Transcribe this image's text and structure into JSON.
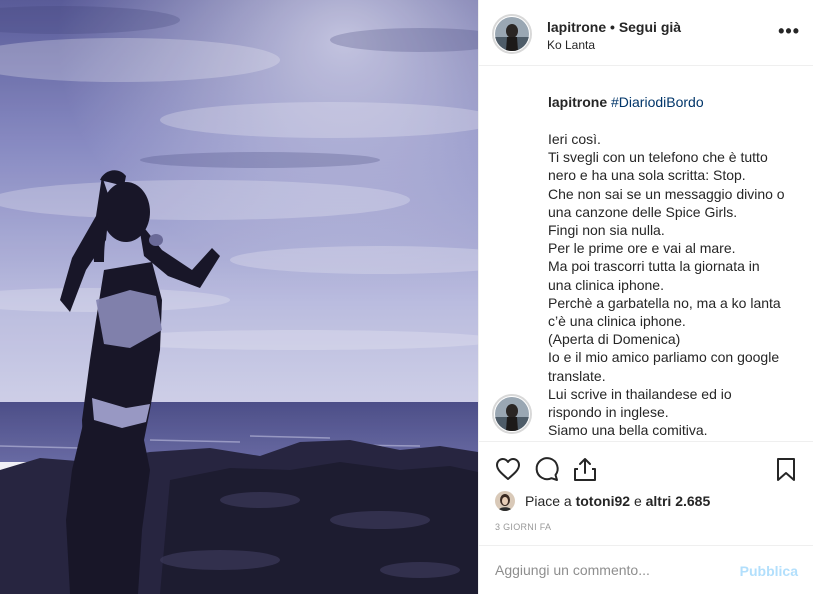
{
  "header": {
    "username": "lapitrone",
    "separator": "•",
    "follow_label": "Segui già",
    "location": "Ko Lanta",
    "more_icon": "more-options-icon",
    "more_glyph": "•••"
  },
  "caption": {
    "username": "lapitrone",
    "hashtag": "#DiariodiBordo",
    "lines": [
      "Ieri così.",
      "Ti svegli con un telefono che è tutto",
      "nero e ha una sola scritta: Stop.",
      "Che non sai se un messaggio divino o",
      "una canzone delle Spice Girls.",
      "Fingi non sia nulla.",
      "Per le prime ore e vai al mare.",
      "Ma poi trascorri tutta la giornata in",
      "una clinica iphone.",
      "Perchè a garbatella no, ma a ko lanta",
      "c’è una clinica iphone.",
      "(Aperta di Domenica)",
      "Io e il mio amico parliamo con google",
      "translate.",
      "Lui scrive in thailandese ed io",
      "rispondo in inglese.",
      "Siamo una bella comitiva."
    ]
  },
  "actions": {
    "icons": [
      "heart-icon",
      "comment-icon",
      "share-icon",
      "bookmark-icon"
    ],
    "likes_prefix": "Piace a",
    "likes_user": "totoni92",
    "likes_middle": "e",
    "likes_count": "altri 2.685",
    "timestamp": "3 GIORNI FA"
  },
  "comment": {
    "placeholder": "Aggiungi un commento...",
    "publish_label": "Pubblica"
  },
  "colors": {
    "link": "#003569",
    "publish_disabled": "#b2dffc",
    "border": "#efefef",
    "sky": "#8b8fc9"
  }
}
